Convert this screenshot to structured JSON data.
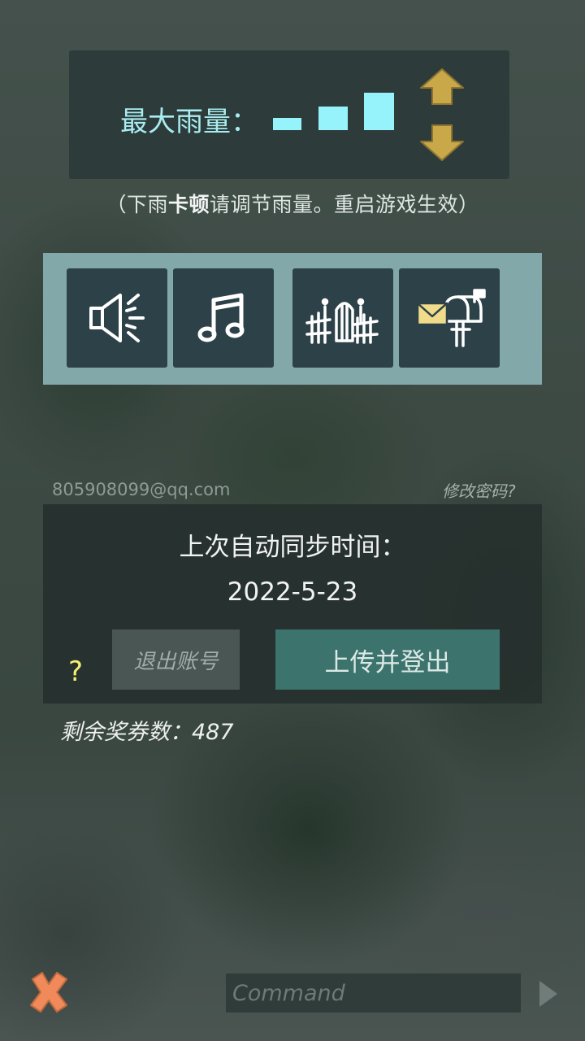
{
  "rain_settings": {
    "label": "最大雨量：",
    "levels": [
      "low",
      "medium",
      "high"
    ],
    "up_icon": "arrow-up-icon",
    "down_icon": "arrow-down-icon",
    "note_prefix": "（下雨",
    "note_bold": "卡顿",
    "note_suffix": "请调节雨量。重启游戏生效）",
    "bar_color": "#96f3fb"
  },
  "icon_buttons": [
    {
      "name": "sound",
      "icon": "speaker-icon"
    },
    {
      "name": "music",
      "icon": "music-note-icon"
    },
    {
      "name": "fence",
      "icon": "fence-icon"
    },
    {
      "name": "mailbox",
      "icon": "mailbox-icon"
    }
  ],
  "account": {
    "email": "805908099@qq.com",
    "change_password": "修改密码?"
  },
  "sync": {
    "title": "上次自动同步时间：",
    "date": "2022-5-23",
    "logout_label": "退出账号",
    "upload_label": "上传并登出",
    "help": "?"
  },
  "tickets": {
    "label": "剩余奖券数：487"
  },
  "command": {
    "placeholder": "Command"
  },
  "colors": {
    "accent_cyan": "#96f3fb",
    "arrow_gold": "#c9a84a",
    "close_orange": "#f08a5a",
    "upload_teal": "#3c736d"
  }
}
